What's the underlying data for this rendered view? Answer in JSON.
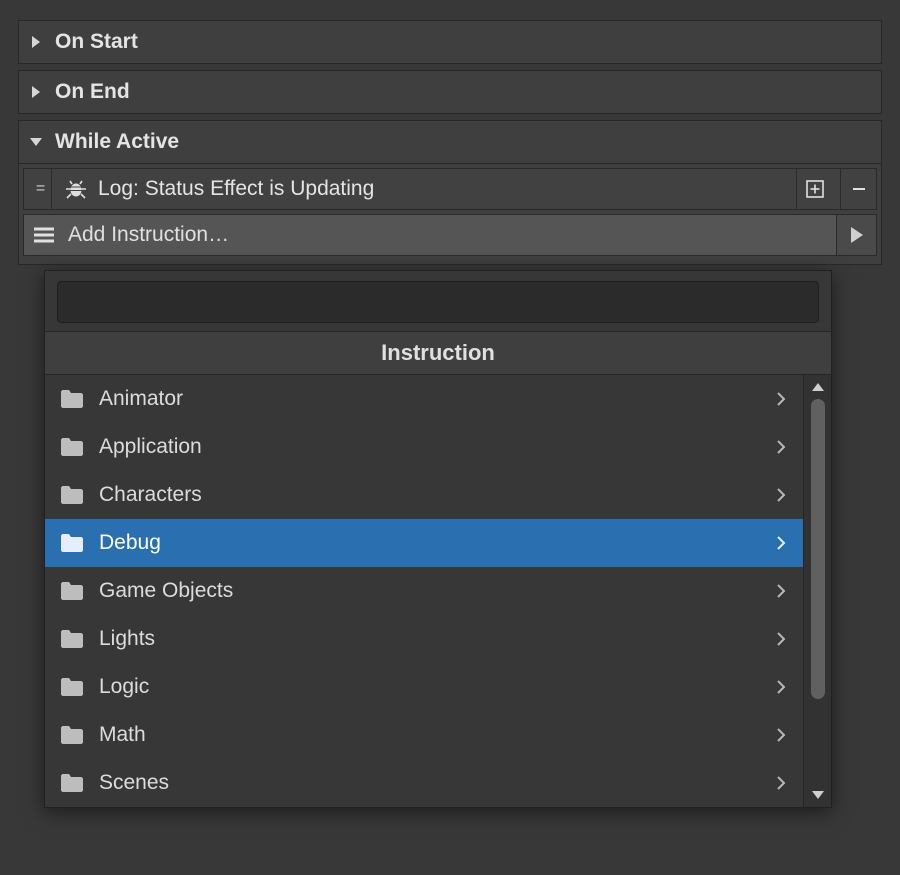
{
  "sections": {
    "on_start": {
      "title": "On Start",
      "expanded": false
    },
    "on_end": {
      "title": "On End",
      "expanded": false
    },
    "while_active": {
      "title": "While Active",
      "expanded": true,
      "instruction": {
        "label": "Log: Status Effect is Updating"
      },
      "add_label": "Add Instruction…"
    }
  },
  "dropdown": {
    "header": "Instruction",
    "search_value": "",
    "categories": [
      {
        "name": "Animator",
        "selected": false
      },
      {
        "name": "Application",
        "selected": false
      },
      {
        "name": "Characters",
        "selected": false
      },
      {
        "name": "Debug",
        "selected": true
      },
      {
        "name": "Game Objects",
        "selected": false
      },
      {
        "name": "Lights",
        "selected": false
      },
      {
        "name": "Logic",
        "selected": false
      },
      {
        "name": "Math",
        "selected": false
      },
      {
        "name": "Scenes",
        "selected": false
      }
    ]
  }
}
